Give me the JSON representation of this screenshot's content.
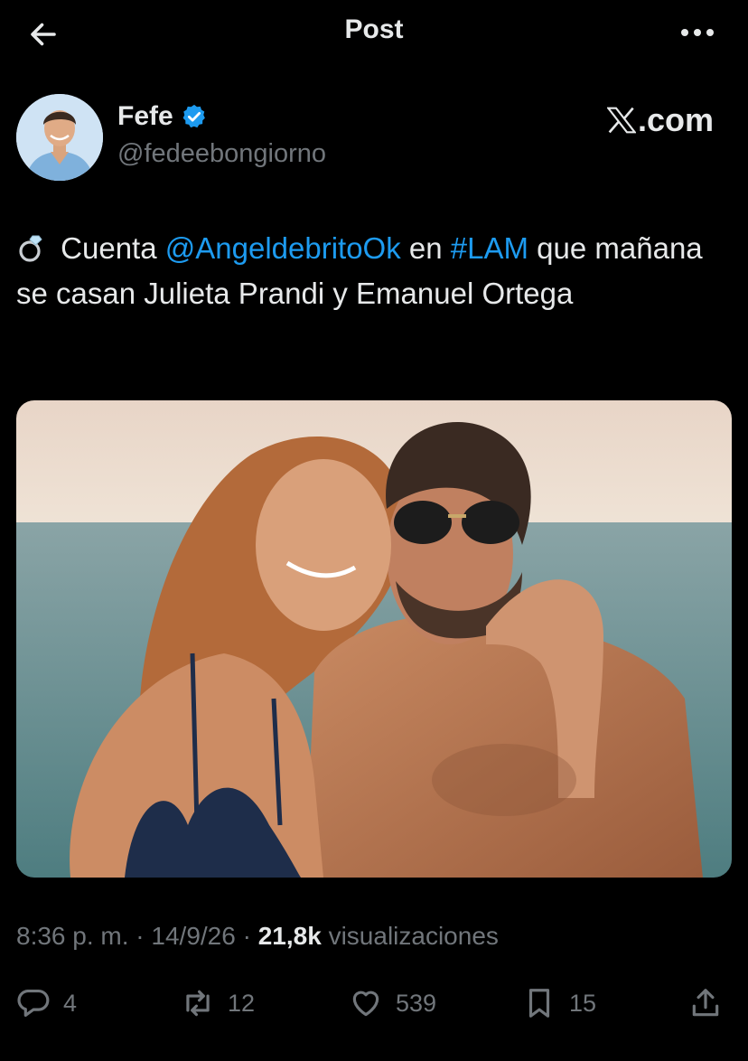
{
  "header": {
    "title": "Post",
    "back_icon": "arrow-left-icon",
    "more_icon": "more-dots-icon"
  },
  "author": {
    "name": "Fefe",
    "handle": "@fedeebongiorno",
    "verified": true,
    "verified_color": "#1d9bf0"
  },
  "brand": {
    "label": ".com",
    "icon": "x-logo-icon"
  },
  "tweet": {
    "emoji_icon": "ring-icon",
    "text_1": " Cuenta ",
    "mention": "@AngeldebritoOk",
    "text_2": " en ",
    "hashtag": "#LAM",
    "text_3": " que mañana se casan Julieta Prandi y Emanuel Ortega",
    "link_color": "#1d9bf0"
  },
  "meta": {
    "time": "8:36 p. m.",
    "sep1": " · ",
    "date": "14/9/26",
    "sep2": " · ",
    "views_count": "21,8k",
    "views_label": " visualizaciones"
  },
  "actions": {
    "replies": "4",
    "reposts": "12",
    "likes": "539",
    "bookmarks": "15"
  },
  "colors": {
    "background": "#000000",
    "text": "#e7e9ea",
    "secondary": "#71767b",
    "accent": "#1d9bf0"
  }
}
